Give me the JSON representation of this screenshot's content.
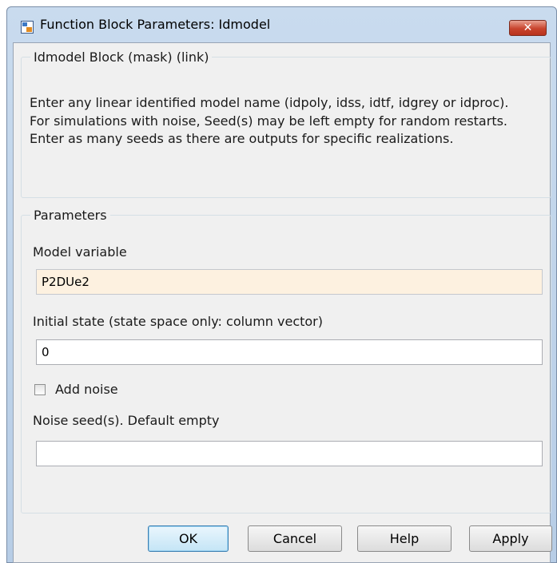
{
  "window": {
    "title": "Function Block Parameters: Idmodel",
    "close_symbol": "✕"
  },
  "description_group": {
    "legend": "Idmodel Block (mask) (link)",
    "lines": [
      "Enter any linear identified model name (idpoly, idss, idtf, idgrey or idproc).",
      "For simulations  with noise, Seed(s) may be left empty for random restarts.",
      "Enter as many seeds as there are outputs for specific realizations."
    ]
  },
  "parameters": {
    "legend": "Parameters",
    "model_variable": {
      "label": "Model variable",
      "value": "P2DUe2"
    },
    "initial_state": {
      "label": "Initial state (state space only: column vector)",
      "value": "0"
    },
    "add_noise": {
      "label": "Add noise",
      "checked": false
    },
    "noise_seed": {
      "label": "Noise seed(s).  Default empty",
      "value": ""
    }
  },
  "buttons": {
    "ok": "OK",
    "cancel": "Cancel",
    "help": "Help",
    "apply": "Apply"
  },
  "icons": {
    "app": "simulink-block-icon",
    "close": "close-icon"
  },
  "colors": {
    "title_bar": "#b9cfe7",
    "close_button": "#c8442d",
    "active_field": "#fdf1e0",
    "panel_background": "#f0f0f0"
  }
}
